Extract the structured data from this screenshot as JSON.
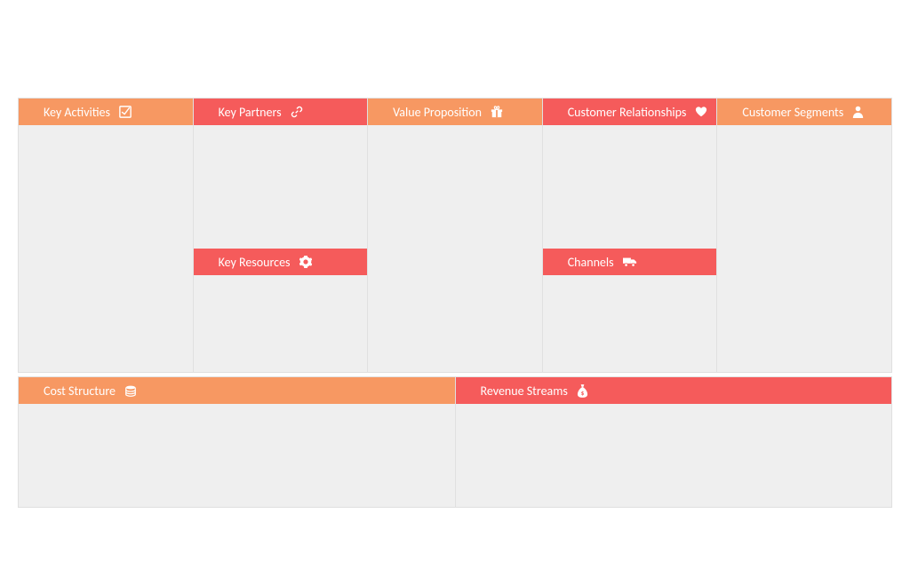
{
  "blocks": {
    "key_activities": {
      "label": "Key Activities",
      "icon": "checkbox-icon",
      "color": "orange"
    },
    "key_partners": {
      "label": "Key Partners",
      "icon": "link-icon",
      "color": "red"
    },
    "key_resources": {
      "label": "Key Resources",
      "icon": "gear-icon",
      "color": "red"
    },
    "value_proposition": {
      "label": "Value Proposition",
      "icon": "gift-icon",
      "color": "orange"
    },
    "customer_relationships": {
      "label": "Customer Relationships",
      "icon": "heart-icon",
      "color": "red"
    },
    "channels": {
      "label": "Channels",
      "icon": "truck-icon",
      "color": "red"
    },
    "customer_segments": {
      "label": "Customer Segments",
      "icon": "person-icon",
      "color": "orange"
    },
    "cost_structure": {
      "label": "Cost Structure",
      "icon": "coins-icon",
      "color": "orange"
    },
    "revenue_streams": {
      "label": "Revenue Streams",
      "icon": "moneybag-icon",
      "color": "red"
    }
  },
  "colors": {
    "orange": "#f79862",
    "red": "#f55b5b",
    "panel": "#efefef"
  }
}
